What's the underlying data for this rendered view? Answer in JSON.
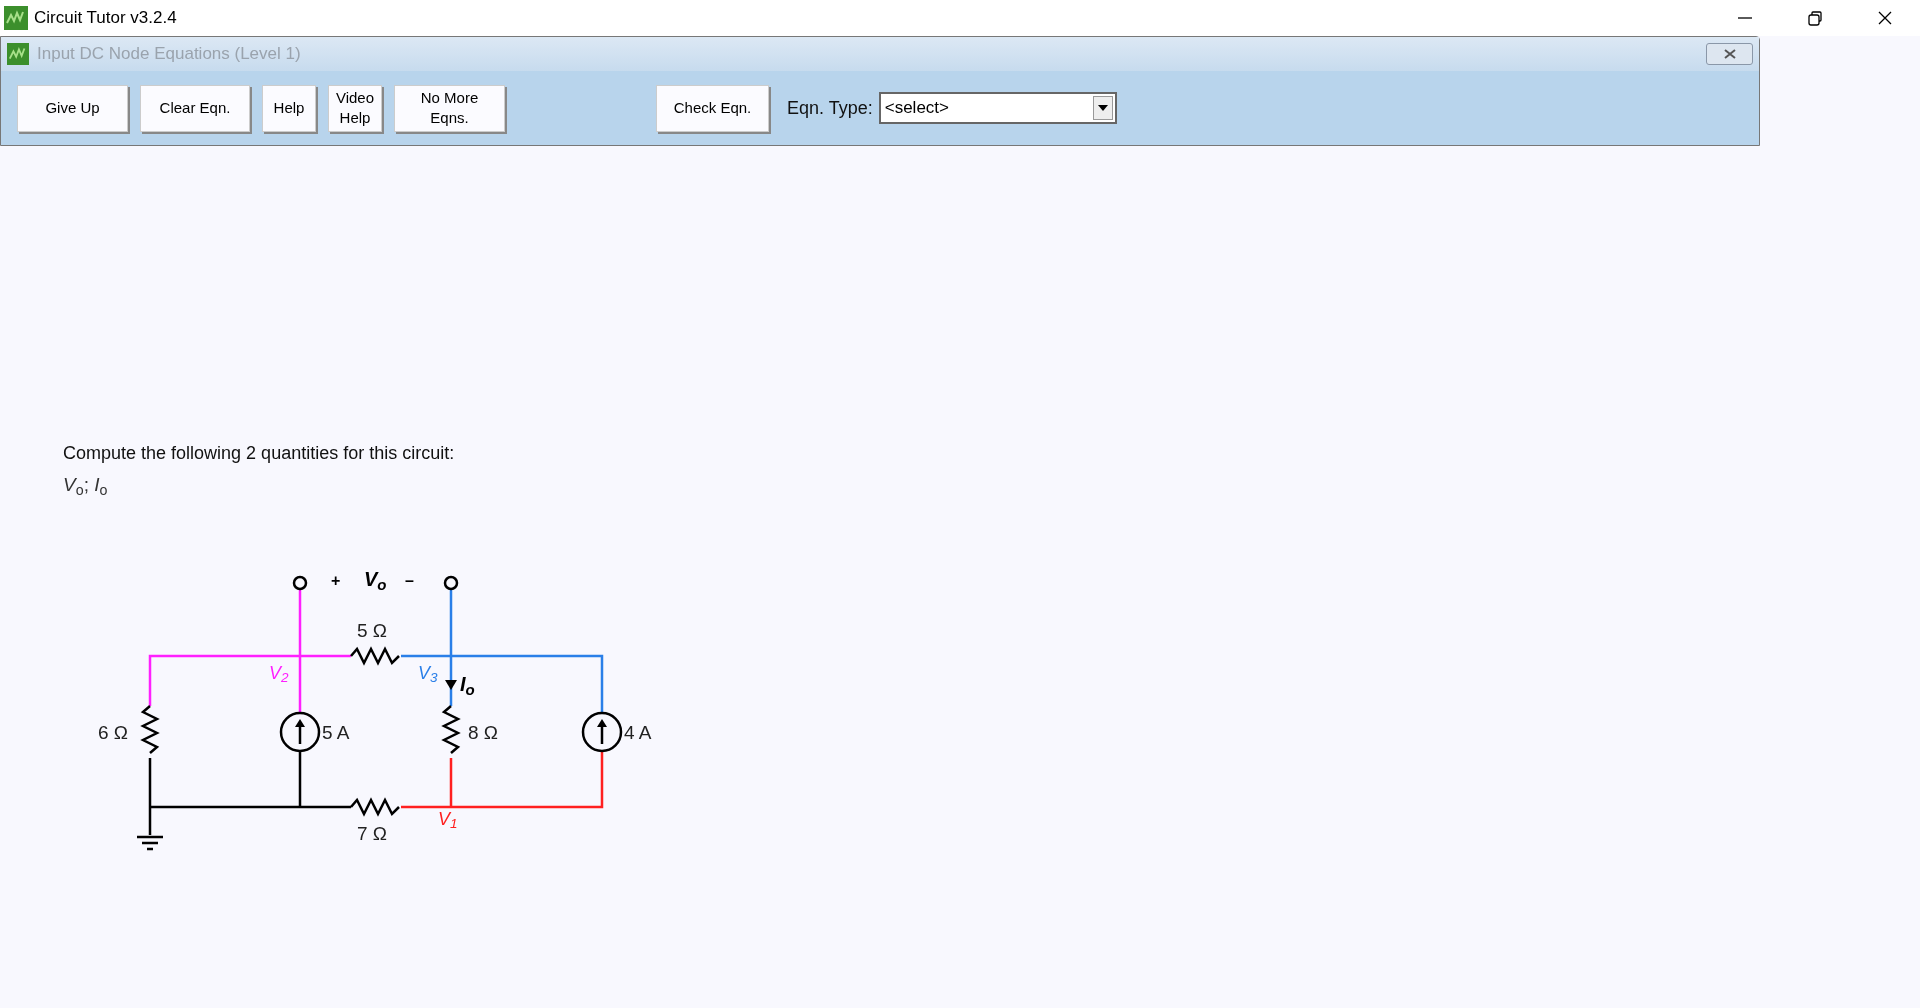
{
  "window": {
    "title": "Circuit Tutor v3.2.4"
  },
  "dialog": {
    "title": "Input DC Node Equations (Level 1)",
    "active": false
  },
  "toolbar": {
    "buttons": [
      {
        "label": "Give Up"
      },
      {
        "label": "Clear Eqn."
      },
      {
        "label": "Help"
      },
      {
        "label": "Video Help"
      },
      {
        "label": "No More Eqns."
      }
    ],
    "check_button": "Check Eqn.",
    "eqn_type": {
      "label": "Eqn. Type:",
      "value": "<select>"
    }
  },
  "problem": {
    "prompt": "Compute the following 2 quantities for this circuit:",
    "quantities": "*V*$_{o}$;  *I*$_{o}$"
  },
  "circuit": {
    "terminal_plus": "+",
    "output_voltage": "V$_{o}$",
    "terminal_minus": "–",
    "current": "I$_{o}$",
    "nodes": [
      {
        "label": "V$_{1}$",
        "color": "#ff2020"
      },
      {
        "label": "V$_{2}$",
        "color": "#ff20ff"
      },
      {
        "label": "V$_{3}$",
        "color": "#2a7fe8"
      }
    ],
    "components": [
      {
        "kind": "resistor",
        "label": "6 Ω"
      },
      {
        "kind": "source",
        "label": "5 A"
      },
      {
        "kind": "resistor",
        "label": "5 Ω"
      },
      {
        "kind": "resistor",
        "label": "8 Ω"
      },
      {
        "kind": "source",
        "label": "4 A"
      },
      {
        "kind": "resistor",
        "label": "7 Ω"
      }
    ]
  }
}
